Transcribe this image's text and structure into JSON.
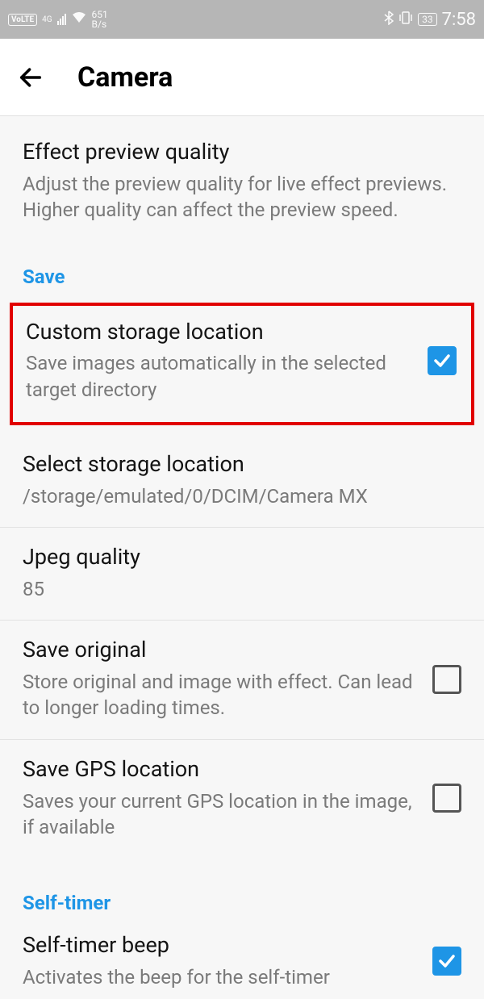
{
  "statusbar": {
    "volte": "VoLTE",
    "net_gen": "4G",
    "speed_top": "651",
    "speed_bottom": "B/s",
    "battery": "33",
    "time": "7:58"
  },
  "header": {
    "title": "Camera"
  },
  "items": {
    "effect_preview": {
      "title": "Effect preview quality",
      "subtitle": "Adjust the preview quality for live effect previews. Higher quality can affect the preview speed."
    },
    "custom_storage": {
      "title": "Custom storage location",
      "subtitle": "Save images automatically in the selected target directory"
    },
    "select_storage": {
      "title": "Select storage location",
      "subtitle": "/storage/emulated/0/DCIM/Camera MX"
    },
    "jpeg_quality": {
      "title": "Jpeg quality",
      "subtitle": "85"
    },
    "save_original": {
      "title": "Save original",
      "subtitle": "Store original and image with effect. Can lead to longer loading times."
    },
    "save_gps": {
      "title": "Save GPS location",
      "subtitle": "Saves your current GPS location in the image, if available"
    },
    "self_timer_beep": {
      "title": "Self-timer beep",
      "subtitle": "Activates the beep for the self-timer"
    }
  },
  "sections": {
    "save": "Save",
    "self_timer": "Self-timer"
  }
}
